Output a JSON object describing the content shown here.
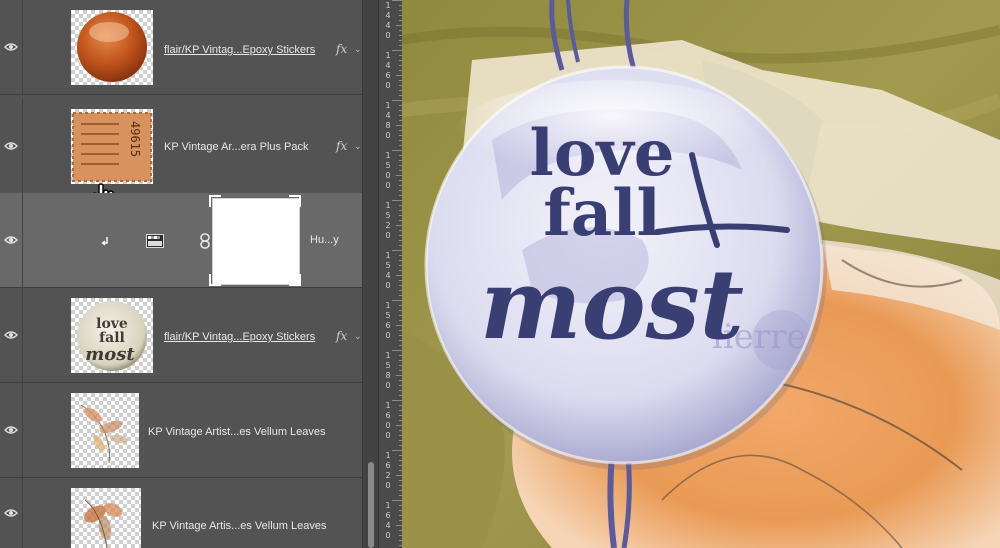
{
  "layers": [
    {
      "name": "flair/KP Vintag...Epoxy Stickers",
      "fx": "fx",
      "chevron": "⌄"
    },
    {
      "name": "KP Vintage Ar...era Plus Pack",
      "fx": "fx",
      "chevron": "⌄",
      "ticket_text": "49615"
    },
    {
      "name": "Hu...y"
    },
    {
      "name": "flair/KP Vintag...Epoxy Stickers",
      "fx": "fx",
      "chevron": "⌄",
      "thumb_text": [
        "love",
        "fall",
        "most"
      ]
    },
    {
      "name": "KP Vintage Artist...es Vellum Leaves"
    },
    {
      "name": "KP Vintage Artis...es Vellum Leaves"
    }
  ],
  "ruler_labels": [
    [
      "1",
      "4",
      "4",
      "0"
    ],
    [
      "1",
      "4",
      "6",
      "0"
    ],
    [
      "1",
      "4",
      "8",
      "0"
    ],
    [
      "1",
      "5",
      "0",
      "0"
    ],
    [
      "1",
      "5",
      "2",
      "0"
    ],
    [
      "1",
      "5",
      "4",
      "0"
    ],
    [
      "1",
      "5",
      "6",
      "0"
    ],
    [
      "1",
      "5",
      "8",
      "0"
    ],
    [
      "1",
      "6",
      "0",
      "0"
    ],
    [
      "1",
      "6",
      "2",
      "0"
    ],
    [
      "1",
      "6",
      "4",
      "0"
    ]
  ],
  "sticker": {
    "line1": "love",
    "line2": "fall",
    "line3": "most",
    "bg_text": "lierre"
  },
  "colors": {
    "panel_bg": "#535353",
    "selected_row": "#696969",
    "sticker_ink": "#3a3f73"
  }
}
